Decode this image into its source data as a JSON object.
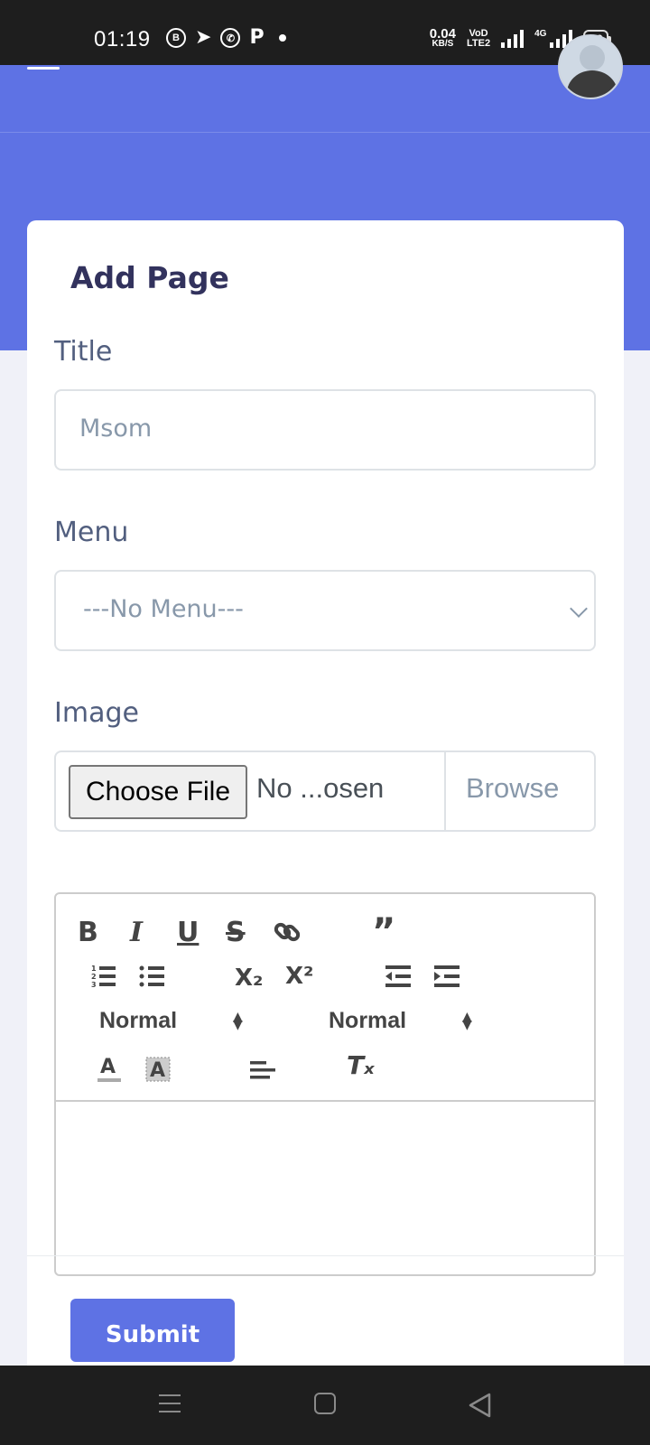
{
  "status_bar": {
    "time": "01:19",
    "app_icons": [
      "B",
      "telegram-icon",
      "whatsapp-icon",
      "P"
    ],
    "net_speed": "0.04",
    "net_unit": "KB/S",
    "volte_top": "VoD",
    "volte_bottom": "LTE2",
    "network": "4G",
    "battery": "80"
  },
  "form": {
    "title": "Add Page",
    "title_label": "Title",
    "title_value": "Msom",
    "menu_label": "Menu",
    "menu_selected": "---No Menu---",
    "image_label": "Image",
    "choose_file_label": "Choose File",
    "file_status": "No ...osen",
    "browse_label": "Browse",
    "submit_label": "Submit"
  },
  "editor": {
    "toolbar": {
      "bold": "B",
      "italic": "I",
      "underline": "U",
      "strike": "S",
      "quote": "”",
      "sub": "X₂",
      "sup": "X²",
      "header_select": "Normal",
      "size_select": "Normal",
      "clean": "Tₓ"
    }
  },
  "colors": {
    "primary": "#5e72e4",
    "page_bg": "#f0f1f8",
    "card_title": "#32325d",
    "label": "#525f7f",
    "placeholder": "#8898aa"
  }
}
